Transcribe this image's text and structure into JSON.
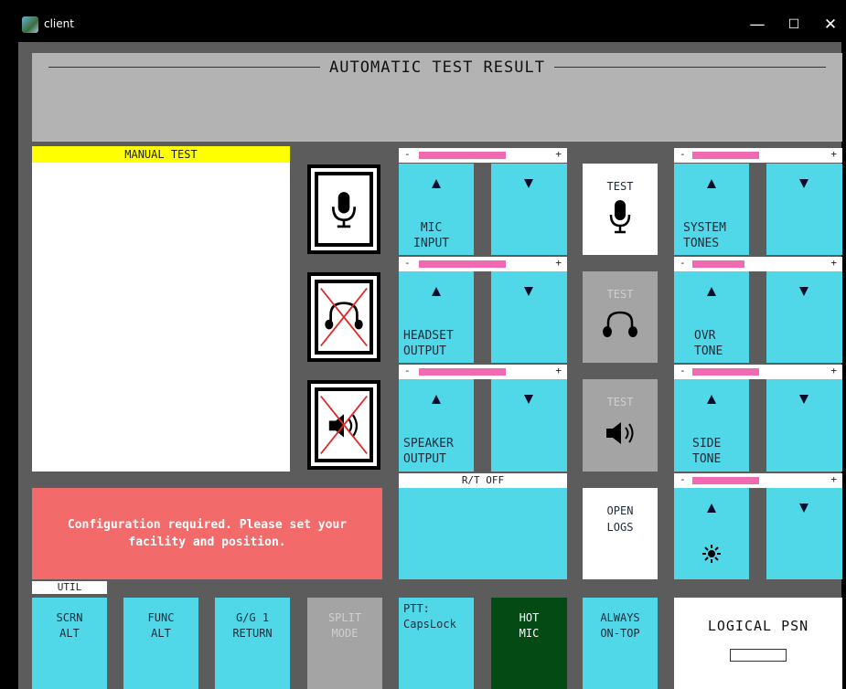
{
  "window": {
    "title": "client",
    "minimize": "—",
    "maximize": "☐",
    "close": "✕"
  },
  "header": {
    "title": "AUTOMATIC TEST RESULT"
  },
  "manual": {
    "title": "MANUAL TEST"
  },
  "config_message": "Configuration required. Please set your facility and position.",
  "volume": {
    "minus": "-",
    "plus": "+",
    "mic_level": 0.52,
    "headset_level": 0.52,
    "speaker_level": 0.52,
    "system_level": 0.4,
    "ovr_level": 0.4,
    "side_level": 0.4,
    "brightness_level": 0.4
  },
  "controls": {
    "mic_input": "MIC\nINPUT",
    "headset_output": "HEADSET\nOUTPUT",
    "speaker_output": "SPEAKER\nOUTPUT",
    "system_tones": "SYSTEM\nTONES",
    "ovr_tone": "OVR\nTONE",
    "side_tone": "SIDE\nTONE",
    "rt_off": "R/T OFF",
    "test": "TEST",
    "open_logs": "OPEN\nLOGS",
    "brightness_icon": "sun-icon"
  },
  "util": {
    "tab": "UTIL",
    "scrn_alt": "SCRN\nALT",
    "func_alt": "FUNC\nALT",
    "gg_return": "G/G 1\nRETURN",
    "split_mode": "SPLIT\nMODE",
    "ptt": "PTT:\nCapsLock",
    "hot_mic": "HOT\nMIC",
    "always_on_top": "ALWAYS\nON-TOP",
    "logical_psn": "LOGICAL PSN"
  },
  "colors": {
    "cyan": "#50d8e8",
    "pink": "#ef6ab1",
    "alert": "#f26a6a",
    "hot_mic": "#044a14",
    "manual_header": "#ffff00"
  }
}
